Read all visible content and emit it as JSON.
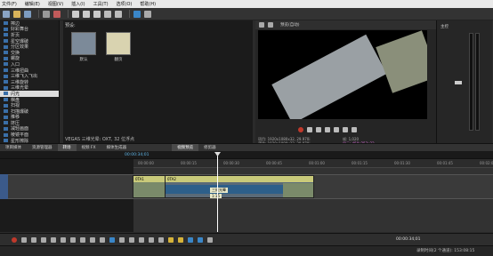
{
  "menu": [
    "文件(F)",
    "编辑(E)",
    "视图(V)",
    "插入(I)",
    "工具(T)",
    "选项(O)",
    "帮助(H)"
  ],
  "fx_tree": {
    "items": [
      "擦边",
      "好彩舞台",
      "折页",
      "星空爆破",
      "分区效果",
      "交换",
      "螺旋",
      "入口",
      "三维扭曲",
      "三维飞入飞出",
      "三维旋转",
      "三维光晕",
      "闪光",
      "棋盘",
      "扫视",
      "扫描爆破",
      "推移",
      "挤压",
      "减轻画面",
      "棱镜平面",
      "星形擦除"
    ],
    "selected_index": 12
  },
  "presets": {
    "title": "预设:",
    "items": [
      {
        "label": "默认",
        "color": "#8ea0b5"
      },
      {
        "label": "翻页",
        "color": "#6a88a8"
      }
    ],
    "description": "VEGAS 三维光晕: OXT, 32 位浮点"
  },
  "preview": {
    "mode_label": "预览(自动)",
    "info": {
      "project": "项目: 1920x1080x32, 29.970i",
      "preview": "预览: 1920x1080x32, 29.970i",
      "frame": "帧: 1,020",
      "display": "显示: 450x253x32"
    }
  },
  "tabs": {
    "bottom_left": [
      "项目媒体",
      "资源管理器",
      "转场",
      "视频 FX",
      "媒体生成器"
    ],
    "bottom_right": [
      "视频预览",
      "修剪器"
    ],
    "mixer": "主控"
  },
  "timeline": {
    "timecode": "00:00:34;01",
    "ruler_ticks": [
      "00:00:00",
      "00:00:15",
      "00:00:30",
      "00:00:45",
      "00:01:00",
      "00:01:15",
      "00:01:30",
      "00:01:45",
      "00:02:00"
    ],
    "clip_a_label": "0TA1",
    "clip_b_label": "0TA2",
    "transition_label": "三维光晕",
    "transition_duration": "1:15"
  },
  "bottom_bar": {
    "time": "00:00:34;01",
    "zoom_hint": "完"
  },
  "status": {
    "text": "录制时间(2 个通道): 153:08:15"
  },
  "colors": {
    "accent": "#3a86c8",
    "record": "#c0392b",
    "clip_header": "#c9ca7a"
  }
}
